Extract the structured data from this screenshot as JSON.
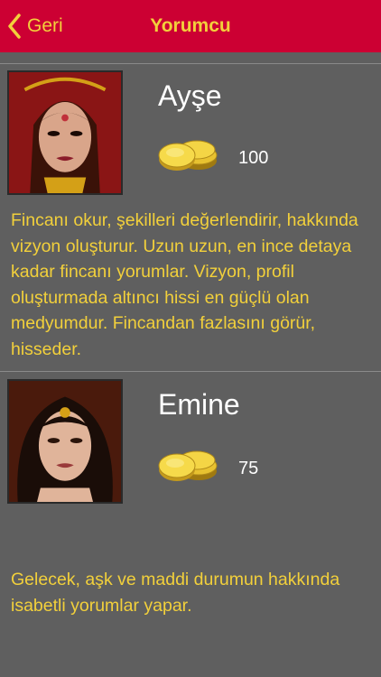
{
  "nav": {
    "back_label": "Geri",
    "title": "Yorumcu"
  },
  "readers": [
    {
      "name": "Ayşe",
      "coins": "100",
      "description": "Fincanı okur, şekilleri değerlendirir, hakkında vizyon oluşturur. Uzun uzun, en ince detaya kadar fincanı yorumlar. Vizyon, profil oluşturmada altıncı hissi en güçlü olan medyumdur. Fincandan fazlasını görür, hisseder."
    },
    {
      "name": "Emine",
      "coins": "75",
      "description": "Gelecek, aşk ve maddi durumun hakkında isabetli yorumlar yapar."
    }
  ],
  "colors": {
    "navbar": "#cc0033",
    "accent": "#f2d03b",
    "background": "#5f5f5f"
  },
  "icons": {
    "back": "chevron-left-icon",
    "coins": "gold-coins-icon"
  }
}
